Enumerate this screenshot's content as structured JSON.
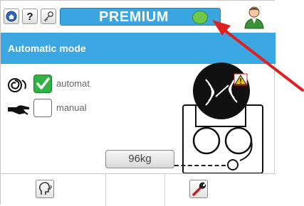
{
  "topbar": {
    "premium_label": "PREMIUM",
    "status_color": "#6cc94a",
    "help_label": "?"
  },
  "header": {
    "title": "Automatic mode"
  },
  "modes": {
    "automatic": {
      "label": "automat",
      "checked": true
    },
    "manual": {
      "label": "manual",
      "checked": false
    }
  },
  "weight": {
    "value": "96kg"
  },
  "colors": {
    "accent": "#3aa7e2",
    "status_ok": "#6cc94a",
    "check_green": "#2fb342",
    "warning": "#f2c200",
    "annotation_arrow": "#e02020"
  },
  "icons": {
    "home": "home-icon",
    "help": "help-icon",
    "settings": "key-icon",
    "user": "user-icon",
    "automatic": "swirl-icon",
    "manual": "hand-icon",
    "voice": "voice-head-icon",
    "tools": "wrench-icon",
    "warning": "warning-icon"
  }
}
